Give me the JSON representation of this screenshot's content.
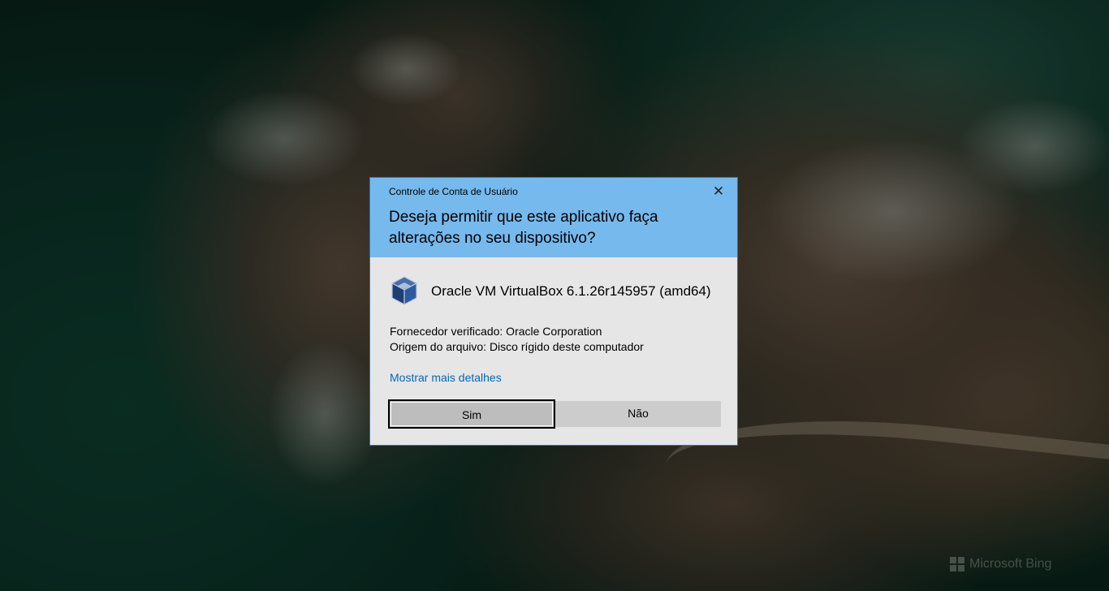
{
  "dialog": {
    "window_title": "Controle de Conta de Usuário",
    "close_glyph": "✕",
    "question": "Deseja permitir que este aplicativo faça alterações no seu dispositivo?",
    "app_icon": "virtualbox-cube-icon",
    "app_name": "Oracle VM VirtualBox 6.1.26r145957 (amd64)",
    "publisher": "Fornecedor verificado: Oracle Corporation",
    "file_origin": "Origem do arquivo: Disco rígido deste computador",
    "more_details_link": "Mostrar mais detalhes",
    "yes_button": "Sim",
    "no_button": "Não"
  },
  "desktop": {
    "watermark": "Microsoft Bing"
  },
  "colors": {
    "header_bg": "#76b9ed",
    "body_bg": "#e6e6e6",
    "border": "#1b78d4",
    "link": "#0067c0",
    "button_bg": "#cccccc"
  }
}
